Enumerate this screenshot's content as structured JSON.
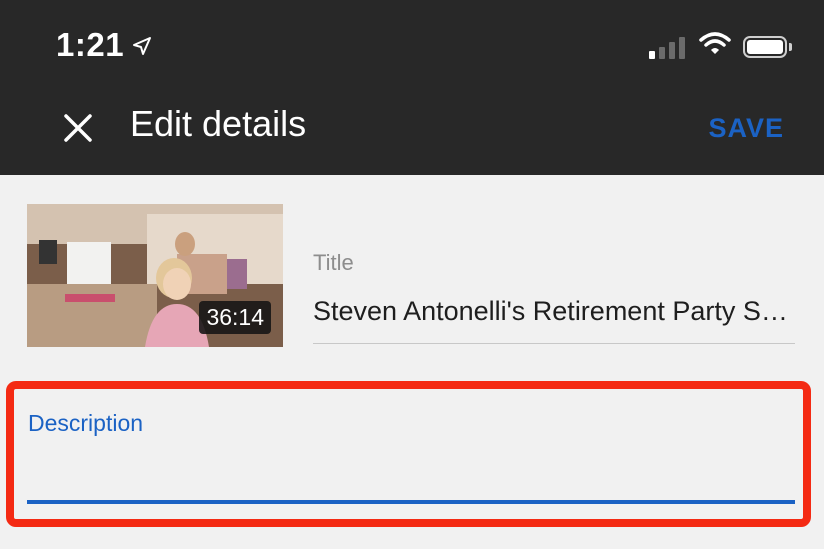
{
  "status_bar": {
    "time": "1:21",
    "icons": [
      "location-arrow-icon",
      "cellular-signal-icon",
      "wifi-icon",
      "battery-icon"
    ]
  },
  "header": {
    "close_icon": "close-icon",
    "title": "Edit details",
    "save_label": "SAVE"
  },
  "video": {
    "duration": "36:14"
  },
  "title_field": {
    "label": "Title",
    "value": "Steven Antonelli's Retirement Party S…"
  },
  "description_field": {
    "label": "Description",
    "value": ""
  },
  "colors": {
    "top_bar": "#282828",
    "accent": "#1b62c4",
    "highlight": "#f42a13",
    "background": "#f1f1f1"
  }
}
